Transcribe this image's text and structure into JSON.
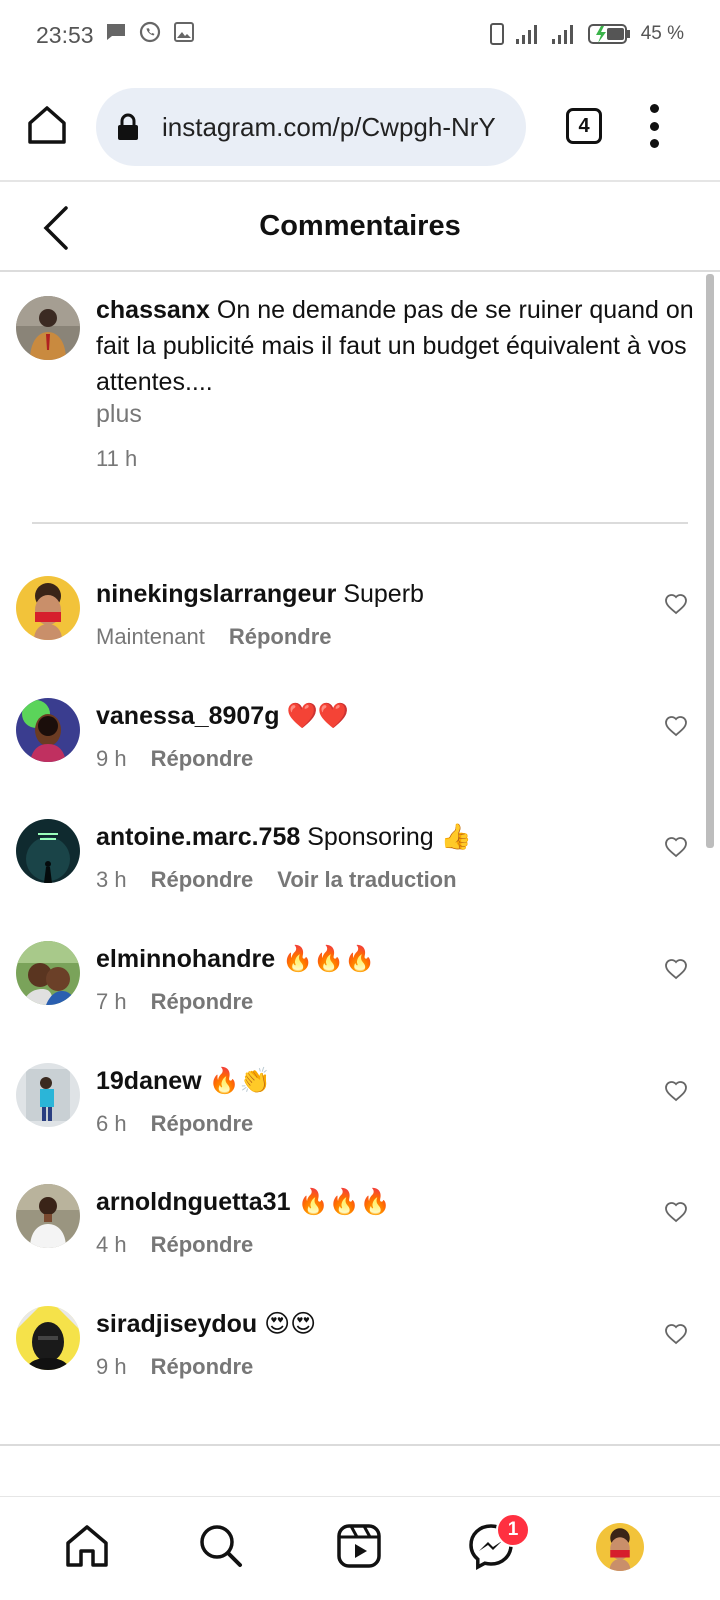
{
  "status_bar": {
    "time": "23:53",
    "battery": "45 %"
  },
  "browser": {
    "url": "instagram.com/p/Cwpgh-NrY",
    "tab_count": "4"
  },
  "header": {
    "title": "Commentaires"
  },
  "caption": {
    "username": "chassanx",
    "text": "On ne demande pas de se ruiner quand on fait la publicité mais il faut un budget équivalent à vos attentes....",
    "more": "plus",
    "time": "11 h"
  },
  "comments": [
    {
      "username": "ninekingslarrangeur",
      "text": "Superb",
      "time": "Maintenant",
      "reply": "Répondre"
    },
    {
      "username": "vanessa_8907g",
      "text": "❤️❤️",
      "time": "9 h",
      "reply": "Répondre"
    },
    {
      "username": "antoine.marc.758",
      "text": "Sponsoring 👍",
      "time": "3 h",
      "reply": "Répondre",
      "translate": "Voir la traduction"
    },
    {
      "username": "elminnohandre",
      "text": "🔥🔥🔥",
      "time": "7 h",
      "reply": "Répondre"
    },
    {
      "username": "19danew",
      "text": "🔥👏",
      "time": "6 h",
      "reply": "Répondre"
    },
    {
      "username": "arnoldnguetta31",
      "text": "🔥🔥🔥",
      "time": "4 h",
      "reply": "Répondre"
    },
    {
      "username": "siradjiseydou",
      "text": "😍😍",
      "time": "9 h",
      "reply": "Répondre"
    }
  ],
  "bottom_nav": {
    "items": [
      "home-icon",
      "search-icon",
      "reels-icon",
      "messenger-icon",
      "profile-avatar"
    ],
    "messages_badge": "1"
  },
  "colors": {
    "badge": "#ff3040",
    "url_bg": "#e9eef6",
    "muted_text": "#777777"
  }
}
